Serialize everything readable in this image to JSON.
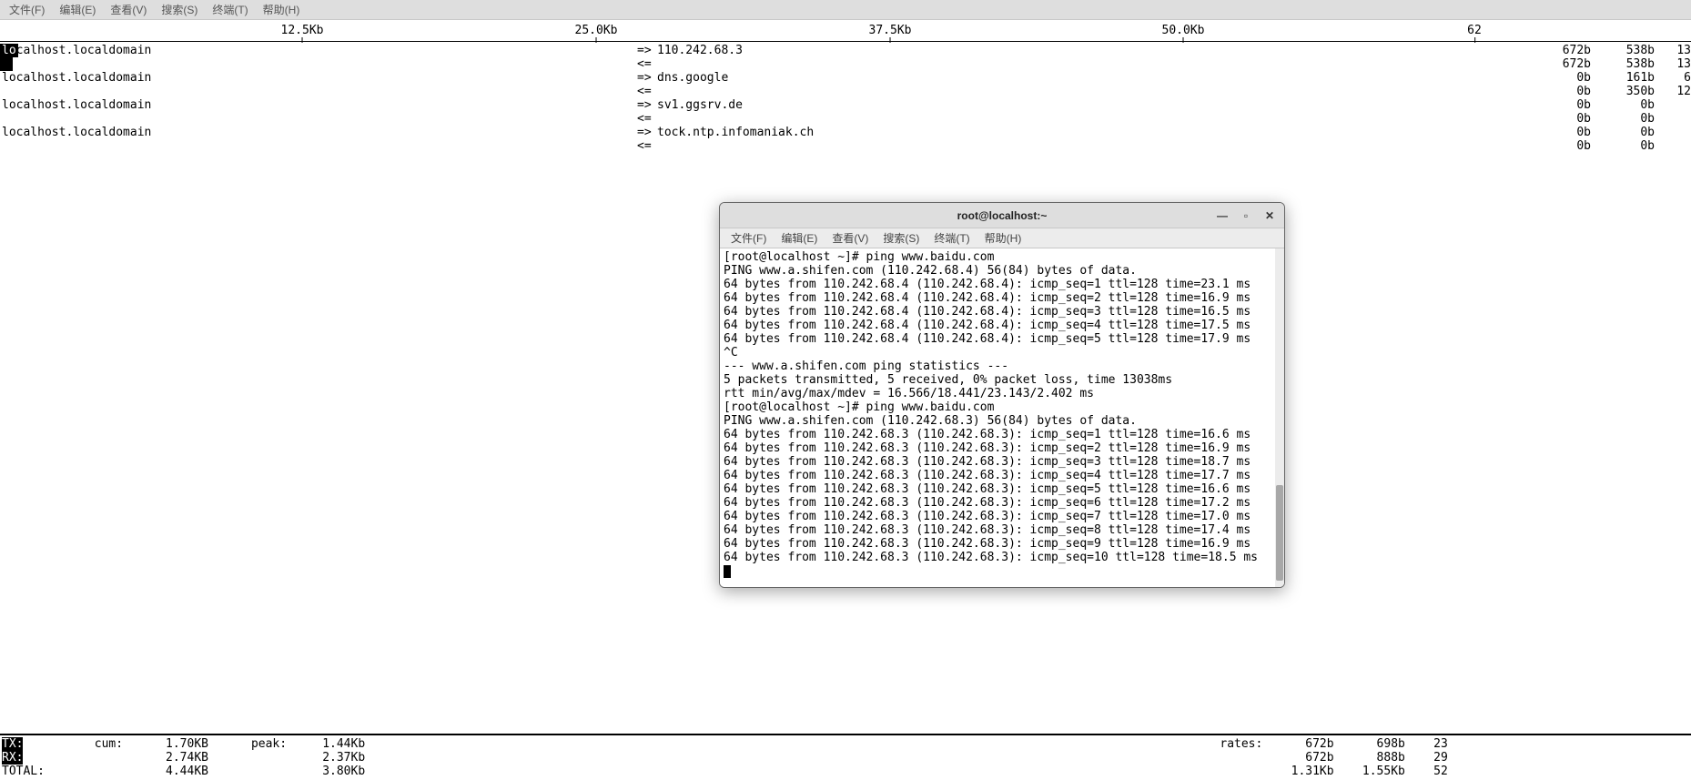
{
  "menubar": [
    "文件(F)",
    "编辑(E)",
    "查看(V)",
    "搜索(S)",
    "终端(T)",
    "帮助(H)"
  ],
  "scale": {
    "ticks": [
      {
        "label": "12.5Kb",
        "pos": 332
      },
      {
        "label": "25.0Kb",
        "pos": 655
      },
      {
        "label": "37.5Kb",
        "pos": 978
      },
      {
        "label": "50.0Kb",
        "pos": 1300
      },
      {
        "label": "62",
        "pos": 1620
      }
    ]
  },
  "conns": [
    {
      "src": "localhost.localdomain",
      "dst": "110.242.68.3",
      "out": [
        "672b",
        "538b",
        "13"
      ],
      "in": [
        "672b",
        "538b",
        "13"
      ],
      "barOut": 20,
      "barIn": 14
    },
    {
      "src": "localhost.localdomain",
      "dst": "dns.google",
      "out": [
        "0b",
        "161b",
        "6"
      ],
      "in": [
        "0b",
        "350b",
        "12"
      ],
      "barOut": 0,
      "barIn": 0
    },
    {
      "src": "localhost.localdomain",
      "dst": "sv1.ggsrv.de",
      "out": [
        "0b",
        "0b",
        ""
      ],
      "in": [
        "0b",
        "0b",
        ""
      ],
      "barOut": 0,
      "barIn": 0
    },
    {
      "src": "localhost.localdomain",
      "dst": "tock.ntp.infomaniak.ch",
      "out": [
        "0b",
        "0b",
        ""
      ],
      "in": [
        "0b",
        "0b",
        ""
      ],
      "barOut": 0,
      "barIn": 0
    }
  ],
  "arrows": {
    "out": "=>",
    "in": "<="
  },
  "totals": {
    "a": {
      "label": "TX:",
      "cum": "cum:",
      "cumv": "1.70KB",
      "peak": "peak:",
      "peakv": "1.44Kb",
      "rates": "rates:",
      "r1": "672b",
      "r2": "698b",
      "r3": "23"
    },
    "b": {
      "label": "RX:",
      "cumv": "2.74KB",
      "peakv": "2.37Kb",
      "r1": "672b",
      "r2": "888b",
      "r3": "29"
    },
    "c": {
      "label": "TOTAL:",
      "cumv": "4.44KB",
      "peakv": "3.80Kb",
      "r1": "1.31Kb",
      "r2": "1.55Kb",
      "r3": "52"
    }
  },
  "termwin": {
    "title": "root@localhost:~",
    "menubar": [
      "文件(F)",
      "编辑(E)",
      "查看(V)",
      "搜索(S)",
      "终端(T)",
      "帮助(H)"
    ],
    "lines": [
      "[root@localhost ~]# ping www.baidu.com",
      "PING www.a.shifen.com (110.242.68.4) 56(84) bytes of data.",
      "64 bytes from 110.242.68.4 (110.242.68.4): icmp_seq=1 ttl=128 time=23.1 ms",
      "64 bytes from 110.242.68.4 (110.242.68.4): icmp_seq=2 ttl=128 time=16.9 ms",
      "64 bytes from 110.242.68.4 (110.242.68.4): icmp_seq=3 ttl=128 time=16.5 ms",
      "64 bytes from 110.242.68.4 (110.242.68.4): icmp_seq=4 ttl=128 time=17.5 ms",
      "64 bytes from 110.242.68.4 (110.242.68.4): icmp_seq=5 ttl=128 time=17.9 ms",
      "^C",
      "--- www.a.shifen.com ping statistics ---",
      "5 packets transmitted, 5 received, 0% packet loss, time 13038ms",
      "rtt min/avg/max/mdev = 16.566/18.441/23.143/2.402 ms",
      "[root@localhost ~]# ping www.baidu.com",
      "PING www.a.shifen.com (110.242.68.3) 56(84) bytes of data.",
      "64 bytes from 110.242.68.3 (110.242.68.3): icmp_seq=1 ttl=128 time=16.6 ms",
      "64 bytes from 110.242.68.3 (110.242.68.3): icmp_seq=2 ttl=128 time=16.9 ms",
      "64 bytes from 110.242.68.3 (110.242.68.3): icmp_seq=3 ttl=128 time=18.7 ms",
      "64 bytes from 110.242.68.3 (110.242.68.3): icmp_seq=4 ttl=128 time=17.7 ms",
      "64 bytes from 110.242.68.3 (110.242.68.3): icmp_seq=5 ttl=128 time=16.6 ms",
      "64 bytes from 110.242.68.3 (110.242.68.3): icmp_seq=6 ttl=128 time=17.2 ms",
      "64 bytes from 110.242.68.3 (110.242.68.3): icmp_seq=7 ttl=128 time=17.0 ms",
      "64 bytes from 110.242.68.3 (110.242.68.3): icmp_seq=8 ttl=128 time=17.4 ms",
      "64 bytes from 110.242.68.3 (110.242.68.3): icmp_seq=9 ttl=128 time=16.9 ms",
      "64 bytes from 110.242.68.3 (110.242.68.3): icmp_seq=10 ttl=128 time=18.5 ms"
    ]
  }
}
